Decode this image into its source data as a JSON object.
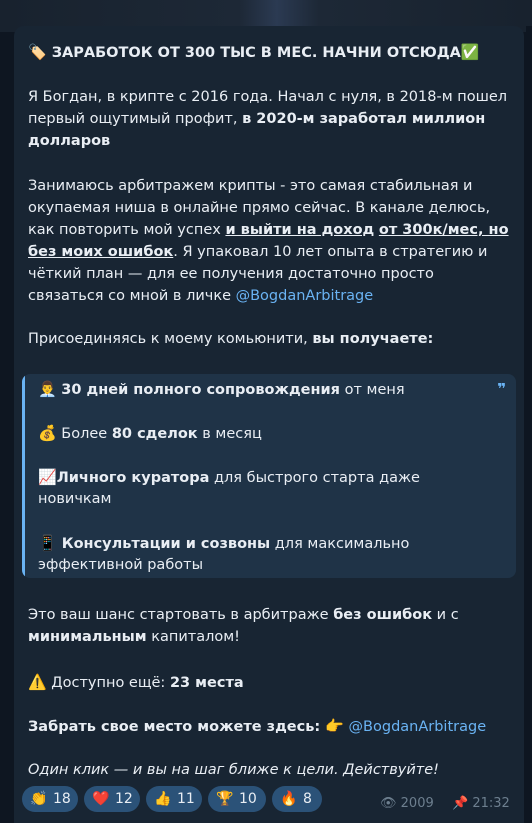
{
  "post": {
    "title_emoji": "🏷️",
    "title": "ЗАРАБОТОК ОТ 300 ТЫС В МЕС. НАЧНИ ОТСЮДА",
    "title_check": "✅",
    "intro_l1": "Я Богдан, в крипте с 2016 года. Начал с нуля, в 2018-м пошел",
    "intro_l2a": "первый ощутимый профит, ",
    "intro_l2b": "в 2020-м заработал миллион",
    "intro_l3": "долларов",
    "p2_l1": "Занимаюсь арбитражем крипты  - это самая стабильная и",
    "p2_l2": "окупаемая ниша в онлайне прямо сейчас. В канале делюсь,",
    "p2_l3a": "как повторить мой успех ",
    "p2_l3b": "и выйти на доход",
    "p2_l3c": " ",
    "p2_l3d": "от 300к/мес, но",
    "p2_l4a": "без моих ошибок",
    "p2_l4b": ". Я упаковал 10 лет опыта в стратегию и",
    "p2_l5": "чёткий план — для ее получения достаточно просто",
    "p2_l6a": "связаться со мной в личке ",
    "p2_l6b": "@BogdanArbitrage",
    "p3a": "Присоединяясь к моему комьюнити, ",
    "p3b": "вы получаете:",
    "quote": {
      "mark": "❞",
      "i1_emoji": "👨‍💼",
      "i1_bold": "30 дней полного сопровождения",
      "i1_rest": " от меня",
      "i2_emoji": "💰",
      "i2_pre": " Более ",
      "i2_bold": "80 сделок",
      "i2_rest": " в месяц",
      "i3_emoji": "📈",
      "i3_bold": "Личного куратора",
      "i3_rest": " для быстрого старта даже",
      "i3_l2": "новичкам",
      "i4_emoji": "📱",
      "i4_bold": " Консультации и созвоны",
      "i4_rest": " для максимально",
      "i4_l2": "эффективной работы"
    },
    "p4_l1a": "Это ваш шанс стартовать в арбитраже ",
    "p4_l1b": "без ошибок",
    "p4_l1c": " и с",
    "p4_l2a": "минимальным",
    "p4_l2b": " капиталом!",
    "p5_emoji": "⚠️",
    "p5a": " Доступно ещё: ",
    "p5b": "23 места",
    "p6a": "Забрать свое место можете здесь: ",
    "p6_emoji": "👉",
    "p6b": " @BogdanArbitrage",
    "p7": "Один клик — и вы на шаг ближе к цели. Действуйте!"
  },
  "reactions": [
    {
      "emoji": "👏",
      "count": "18"
    },
    {
      "emoji": "❤️",
      "count": "12"
    },
    {
      "emoji": "👍",
      "count": "11"
    },
    {
      "emoji": "🏆",
      "count": "10"
    },
    {
      "emoji": "🔥",
      "count": "8"
    }
  ],
  "meta": {
    "views_icon": "👁",
    "views": "2009",
    "pin_icon": "📌",
    "time": "21:32"
  },
  "colors": {
    "background": "#0e1621",
    "bubble": "#182533",
    "link": "#6ab3f3",
    "quote_bg": "#1f3347",
    "reaction_bg": "#2b5278"
  }
}
